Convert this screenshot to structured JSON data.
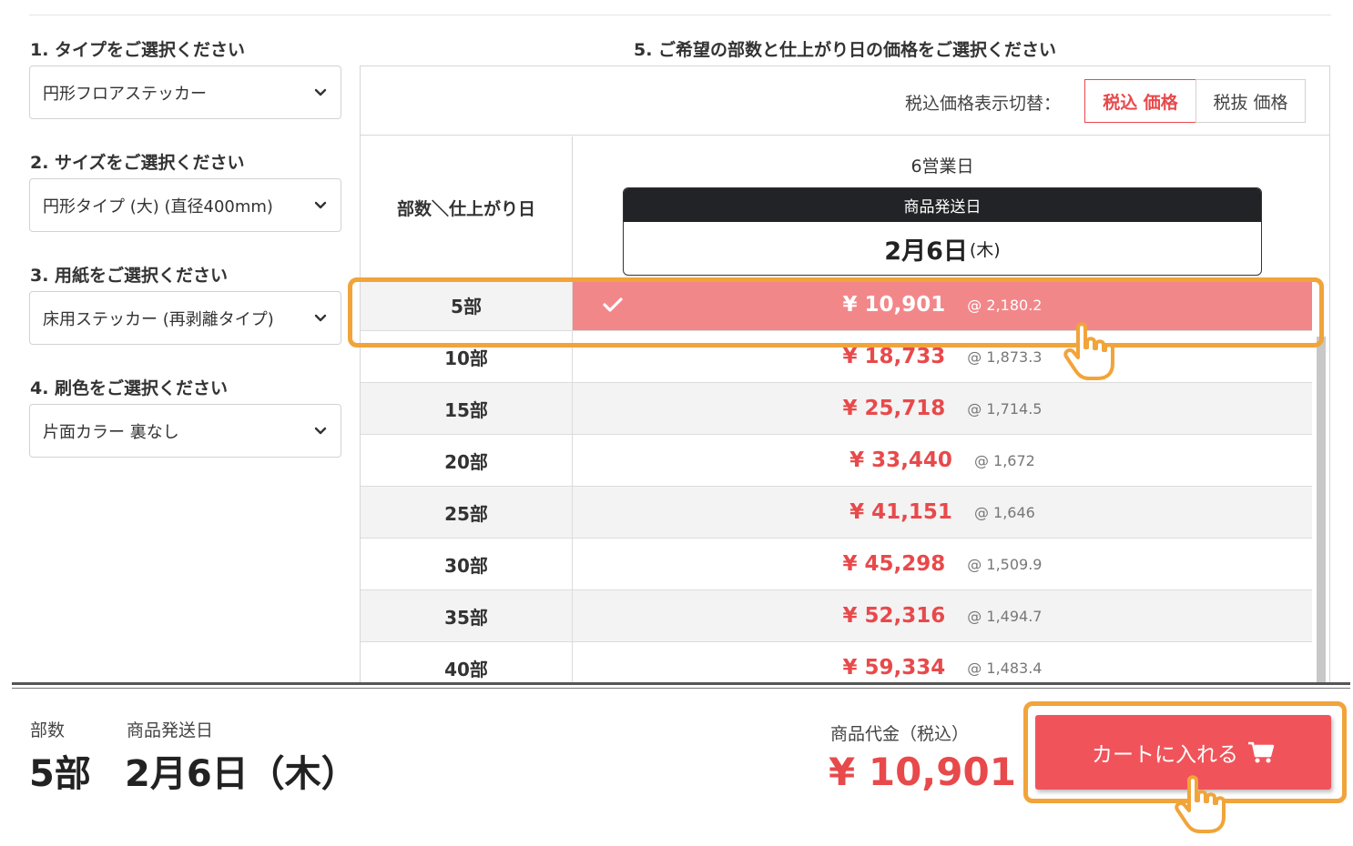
{
  "steps": [
    {
      "title": "1. タイプをご選択ください",
      "value": "円形フロアステッカー"
    },
    {
      "title": "2. サイズをご選択ください",
      "value": "円形タイプ (大) (直径400mm)"
    },
    {
      "title": "3. 用紙をご選択ください",
      "value": "床用ステッカー (再剥離タイプ)"
    },
    {
      "title": "4. 刷色をご選択ください",
      "value": "片面カラー 裏なし"
    }
  ],
  "price_panel": {
    "title": "5. ご希望の部数と仕上がり日の価格をご選択ください",
    "toggle_label": "税込価格表示切替：",
    "toggle_on": "税込 価格",
    "toggle_off": "税抜 価格",
    "head_left": "部数＼仕上がり日",
    "business_days": "6営業日",
    "ship_header": "商品発送日",
    "ship_date": "2月6日",
    "ship_weekday": "(木)",
    "rows": [
      {
        "qty": "5部",
        "price": "¥ 10,901",
        "unit": "@ 2,180.2",
        "selected": true
      },
      {
        "qty": "10部",
        "price": "¥ 18,733",
        "unit": "@ 1,873.3"
      },
      {
        "qty": "15部",
        "price": "¥ 25,718",
        "unit": "@ 1,714.5"
      },
      {
        "qty": "20部",
        "price": "¥ 33,440",
        "unit": "@ 1,672"
      },
      {
        "qty": "25部",
        "price": "¥ 41,151",
        "unit": "@ 1,646"
      },
      {
        "qty": "30部",
        "price": "¥ 45,298",
        "unit": "@ 1,509.9"
      },
      {
        "qty": "35部",
        "price": "¥ 52,316",
        "unit": "@ 1,494.7"
      },
      {
        "qty": "40部",
        "price": "¥ 59,334",
        "unit": "@ 1,483.4"
      }
    ]
  },
  "summary": {
    "qty_label": "部数",
    "qty_value": "5部",
    "ship_label": "商品発送日",
    "ship_value": "2月6日（木）",
    "total_label": "商品代金（税込）",
    "total_value": "¥ 10,901",
    "cart_button": "カートに入れる"
  },
  "colors": {
    "accent_red": "#e8494b",
    "selected_row": "#f2878a",
    "highlight_orange": "#f1a43a",
    "cart_button": "#f0545a"
  },
  "icons": [
    "chevron-down-icon",
    "check-icon",
    "cart-icon",
    "pointer-hand-icon"
  ]
}
